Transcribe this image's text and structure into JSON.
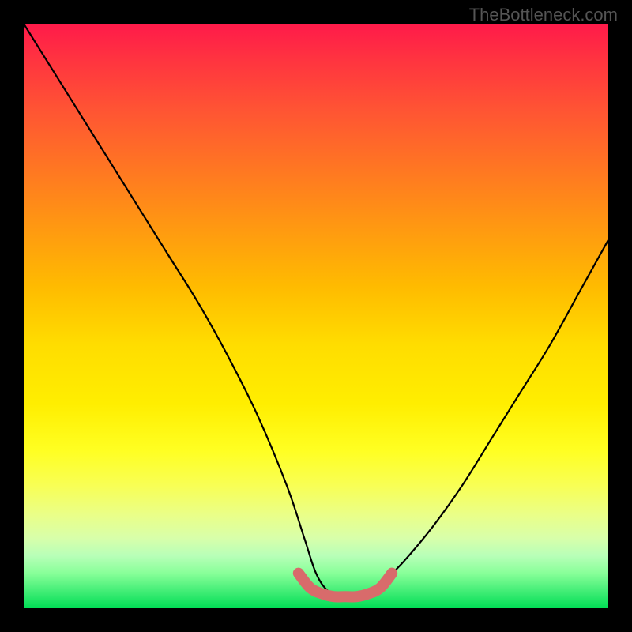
{
  "watermark": "TheBottleneck.com",
  "chart_data": {
    "type": "line",
    "title": "",
    "xlabel": "",
    "ylabel": "",
    "xlim": [
      0,
      100
    ],
    "ylim": [
      0,
      100
    ],
    "series": [
      {
        "name": "bottleneck-curve",
        "x": [
          0,
          5,
          10,
          15,
          20,
          25,
          30,
          35,
          40,
          45,
          48,
          50,
          52,
          54,
          56,
          58,
          60,
          62,
          65,
          70,
          75,
          80,
          85,
          90,
          95,
          100
        ],
        "values": [
          100,
          92,
          84,
          76,
          68,
          60,
          52,
          43,
          33,
          21,
          12,
          6,
          3,
          2,
          2,
          2,
          3,
          5,
          8,
          14,
          21,
          29,
          37,
          45,
          54,
          63
        ]
      },
      {
        "name": "highlight-segment",
        "x": [
          47,
          49,
          51,
          53,
          55,
          57,
          59,
          61,
          63
        ],
        "values": [
          6,
          3.5,
          2.5,
          2,
          2,
          2,
          2.5,
          3.5,
          6
        ]
      }
    ],
    "gradient_stops": [
      {
        "pos": 0,
        "color": "#ff1a4a"
      },
      {
        "pos": 50,
        "color": "#ffdd00"
      },
      {
        "pos": 100,
        "color": "#00dd55"
      }
    ]
  }
}
